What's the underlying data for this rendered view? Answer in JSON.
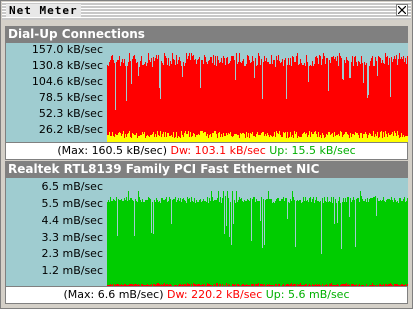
{
  "window": {
    "title": "Net Meter"
  },
  "panels": [
    {
      "name": "Dial-Up Connections",
      "y_labels": [
        "157.0 kB/sec",
        "130.8 kB/sec",
        "104.6 kB/sec",
        "78.5 kB/sec",
        "52.3 kB/sec",
        "26.2 kB/sec"
      ],
      "max_text": "(Max: 160.5 kB/sec)",
      "dw_text": "Dw: 103.1 kB/sec",
      "up_text": "Up: 15.5 kB/sec",
      "colors": {
        "down": "#ff0000",
        "up": "#ffff00",
        "bg": "#9fccd0"
      },
      "ymax": 160.5,
      "down_level": 103.1,
      "up_level": 15.5
    },
    {
      "name": "Realtek RTL8139 Family PCI Fast Ethernet NIC",
      "y_labels": [
        "6.5 mB/sec",
        "5.5 mB/sec",
        "4.4 mB/sec",
        "3.3 mB/sec",
        "2.3 mB/sec",
        "1.2 mB/sec"
      ],
      "max_text": "(Max: 6.6 mB/sec)",
      "dw_text": "Dw: 220.2 kB/sec",
      "up_text": "Up: 5.6 mB/sec",
      "colors": {
        "down": "#ff0000",
        "up": "#00cc00",
        "bg": "#9fccd0"
      },
      "ymax": 6.6,
      "down_level": 0.22,
      "up_level": 5.6
    }
  ]
}
